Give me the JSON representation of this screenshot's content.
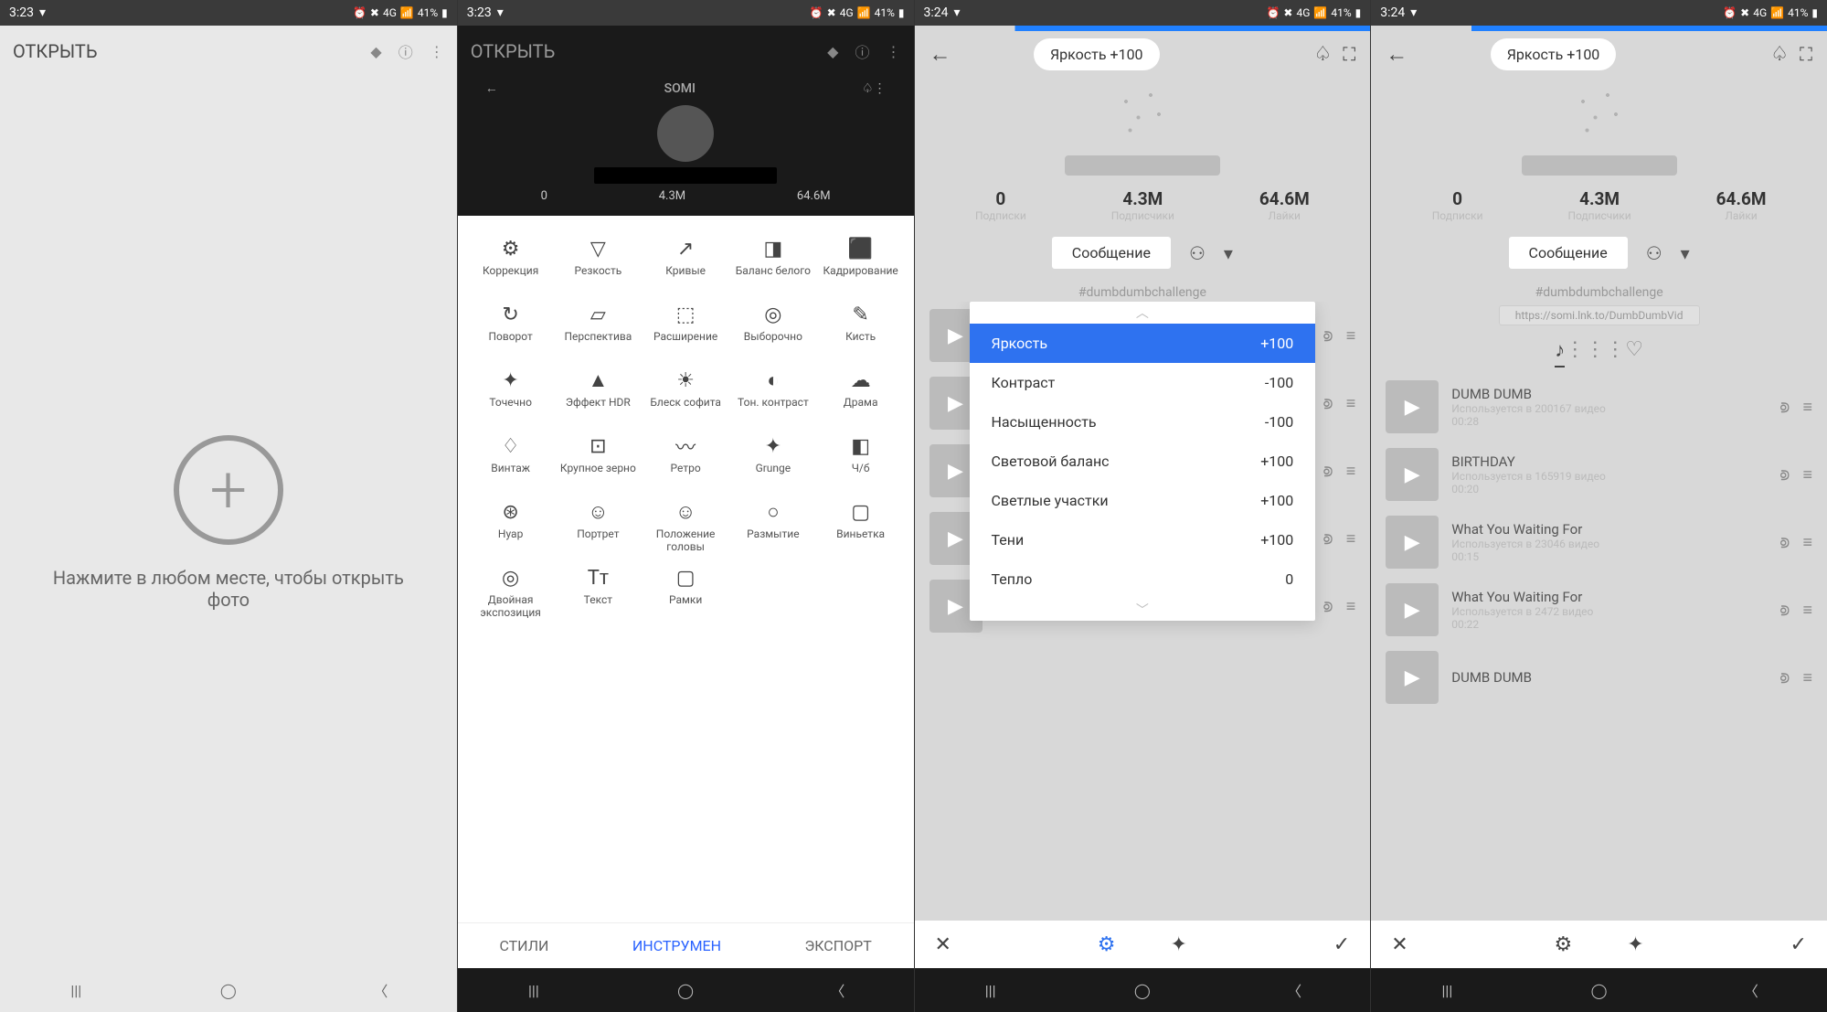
{
  "status": {
    "time1": "3:23",
    "time2": "3:24",
    "battery": "41%",
    "net": "4G"
  },
  "s1": {
    "title": "ОТКРЫТЬ",
    "hint": "Нажмите в любом месте, чтобы открыть фото"
  },
  "s2": {
    "title": "ОТКРЫТЬ",
    "profile_name": "SOMI",
    "stats": [
      "0",
      "4.3M",
      "64.6M"
    ],
    "tools": [
      [
        "Коррекция",
        "Резкость",
        "Кривые",
        "Баланс белого",
        "Кадрирование"
      ],
      [
        "Поворот",
        "Перспектива",
        "Расширение",
        "Выборочно",
        "Кисть"
      ],
      [
        "Точечно",
        "Эффект HDR",
        "Блеск софита",
        "Тон. контраст",
        "Драма"
      ],
      [
        "Винтаж",
        "Крупное зерно",
        "Ретро",
        "Grunge",
        "Ч/б"
      ],
      [
        "Нуар",
        "Портрет",
        "Положение головы",
        "Размытие",
        "Виньетка"
      ],
      [
        "Двойная экспозиция",
        "Текст",
        "Рамки",
        "",
        ""
      ]
    ],
    "tool_icons": [
      [
        "⚙",
        "▽",
        "↗",
        "◨",
        "⬛"
      ],
      [
        "↻",
        "▱",
        "⬚",
        "◎",
        "✎"
      ],
      [
        "✦",
        "▲",
        "☀",
        "◐",
        "☁"
      ],
      [
        "♢",
        "⊡",
        "〰",
        "✦",
        "◧"
      ],
      [
        "⊛",
        "☺",
        "☺",
        "○",
        "▢"
      ],
      [
        "◎",
        "Tᴛ",
        "▢",
        "",
        ""
      ]
    ],
    "tabs": {
      "styles": "СТИЛИ",
      "tools": "ИНСТРУМЕН",
      "export": "ЭКСПОРТ"
    }
  },
  "s34": {
    "chip": "Яркость +100",
    "stats": [
      {
        "n": "0",
        "l": "Подписки"
      },
      {
        "n": "4.3M",
        "l": "Подписчики"
      },
      {
        "n": "64.6M",
        "l": "Лайки"
      }
    ],
    "msg": "Сообщение",
    "hashtag": "#dumbdumbchallenge",
    "link": "https://somi.lnk.to/DumbDumbVid",
    "songs": [
      {
        "title": "DUMB DUMB",
        "sub": "Используется в 200167 видео",
        "dur": "00:28"
      },
      {
        "title": "BIRTHDAY",
        "sub": "Используется в 165919 видео",
        "dur": "00:20"
      },
      {
        "title": "What You Waiting For",
        "sub": "Используется в 23046 видео",
        "dur": "00:15"
      },
      {
        "title": "What You Waiting For",
        "sub": "Используется в 2472 видео",
        "dur": "00:22"
      },
      {
        "title": "DUMB DUMB",
        "sub": "",
        "dur": ""
      }
    ],
    "adjustments": [
      {
        "name": "Яркость",
        "val": "+100",
        "sel": true
      },
      {
        "name": "Контраст",
        "val": "-100"
      },
      {
        "name": "Насыщенность",
        "val": "-100"
      },
      {
        "name": "Световой баланс",
        "val": "+100"
      },
      {
        "name": "Светлые участки",
        "val": "+100"
      },
      {
        "name": "Тени",
        "val": "+100"
      },
      {
        "name": "Тепло",
        "val": "0"
      }
    ]
  }
}
